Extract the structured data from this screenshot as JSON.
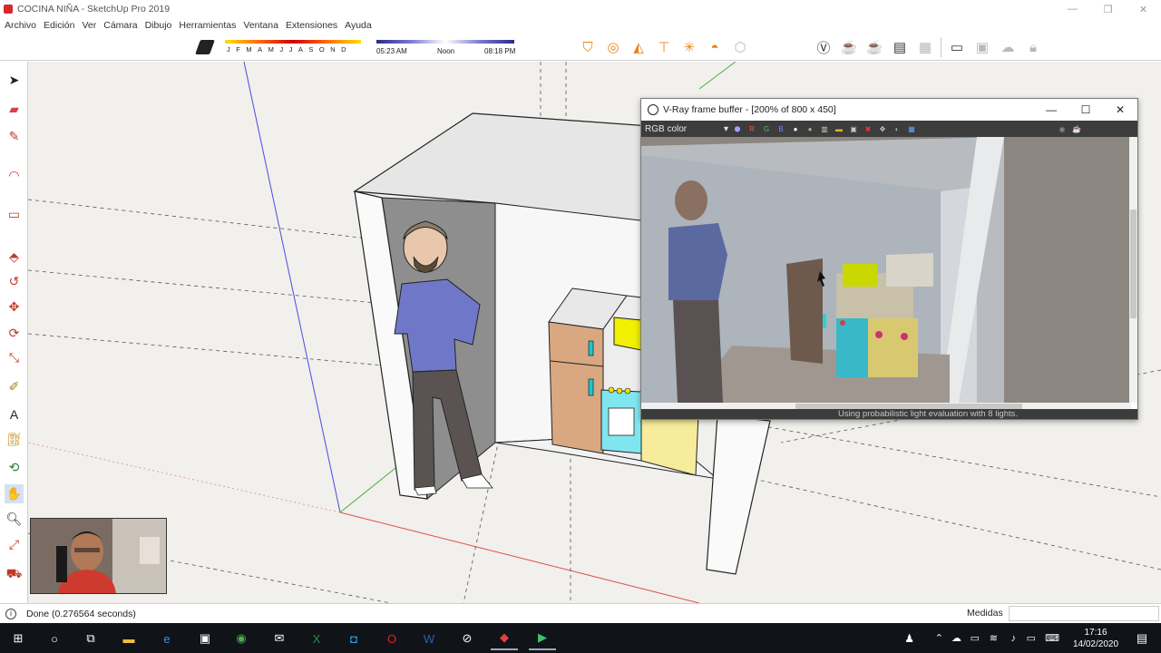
{
  "window": {
    "title": "COCINA NIÑA - SketchUp Pro 2019",
    "controls": [
      "—",
      "❐",
      "✕"
    ]
  },
  "menu": [
    "Archivo",
    "Edición",
    "Ver",
    "Cámara",
    "Dibujo",
    "Herramientas",
    "Ventana",
    "Extensiones",
    "Ayuda"
  ],
  "shadows": {
    "months": [
      "J",
      "F",
      "M",
      "A",
      "M",
      "J",
      "J",
      "A",
      "S",
      "O",
      "N",
      "D"
    ],
    "sunrise": "05:23 AM",
    "noon": "Noon",
    "sunset": "08:18 PM"
  },
  "vray_window": {
    "title": "V-Ray frame buffer - [200% of 800 x 450]",
    "channel_select": "RGB color",
    "channels": [
      "R",
      "G",
      "B"
    ],
    "status": "Using probabilistic light evaluation with 8 lights.",
    "controls": [
      "—",
      "☐",
      "✕"
    ]
  },
  "statusbar": {
    "message": "Done (0.276564 seconds)",
    "measure_label": "Medidas",
    "measure_value": ""
  },
  "taskbar": {
    "time": "17:16",
    "date": "14/02/2020"
  },
  "colors": {
    "accent_orange": "#e9841d",
    "vray_dark": "#3c3c3c",
    "taskbar": "#101418"
  }
}
